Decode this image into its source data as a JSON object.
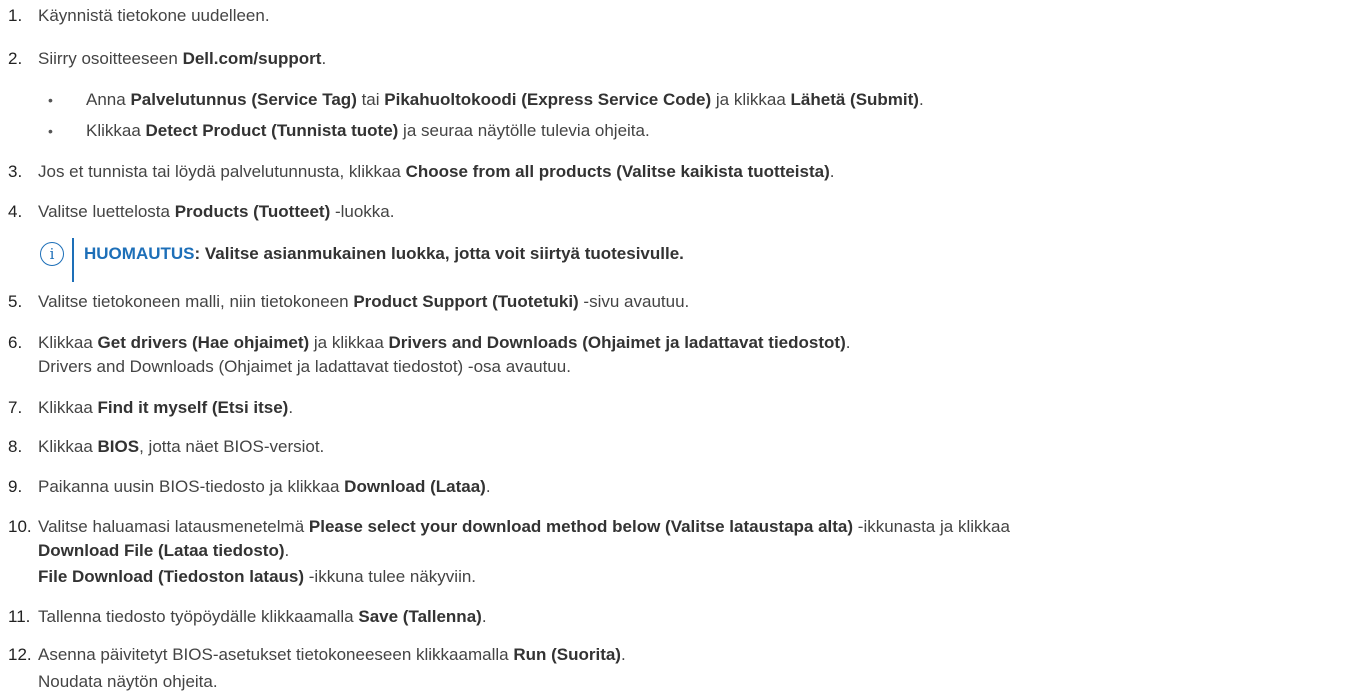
{
  "steps": [
    {
      "num": "1.",
      "text": "Käynnistä tietokone uudelleen."
    },
    {
      "num": "2.",
      "pre": "Siirry osoitteeseen ",
      "b1": "Dell.com/support",
      "post": "."
    },
    {
      "num": "3.",
      "pre": "Jos et tunnista tai löydä palvelutunnusta, klikkaa ",
      "b1": "Choose from all products (Valitse kaikista tuotteista)",
      "post": "."
    },
    {
      "num": "4.",
      "pre": "Valitse luettelosta ",
      "b1": "Products (Tuotteet)",
      "post": " -luokka."
    },
    {
      "num": "5.",
      "pre": "Valitse tietokoneen malli, niin tietokoneen ",
      "b1": "Product Support (Tuotetuki)",
      "post": " -sivu avautuu."
    },
    {
      "num": "6.",
      "pre": "Klikkaa ",
      "b1": "Get drivers (Hae ohjaimet)",
      "mid": " ja klikkaa ",
      "b2": "Drivers and Downloads (Ohjaimet ja ladattavat tiedostot)",
      "post": ".",
      "line2": "Drivers and Downloads (Ohjaimet ja ladattavat tiedostot) -osa avautuu."
    },
    {
      "num": "7.",
      "pre": "Klikkaa ",
      "b1": "Find it myself (Etsi itse)",
      "post": "."
    },
    {
      "num": "8.",
      "pre": "Klikkaa ",
      "b1": "BIOS",
      "post": ", jotta näet BIOS-versiot."
    },
    {
      "num": "9.",
      "pre": "Paikanna uusin BIOS-tiedosto ja klikkaa ",
      "b1": "Download (Lataa)",
      "post": "."
    },
    {
      "num": "10.",
      "pre": "Valitse haluamasi latausmenetelmä ",
      "b1": "Please select your download method below (Valitse lataustapa alta)",
      "post": " -ikkunasta ja klikkaa",
      "line2_b": "Download File (Lataa tiedosto)",
      "line2_post": ".",
      "line3_b": "File Download (Tiedoston lataus)",
      "line3_post": " -ikkuna tulee näkyviin."
    },
    {
      "num": "11.",
      "pre": "Tallenna tiedosto työpöydälle klikkaamalla ",
      "b1": "Save (Tallenna)",
      "post": "."
    },
    {
      "num": "12.",
      "pre": "Asenna päivitetyt BIOS-asetukset tietokoneeseen klikkaamalla ",
      "b1": "Run (Suorita)",
      "post": ".",
      "after": "Noudata näytön ohjeita."
    }
  ],
  "substeps": [
    {
      "bullet": "•",
      "pre": "Anna ",
      "b1": "Palvelutunnus (Service Tag)",
      "mid1": " tai ",
      "b2": "Pikahuoltokoodi (Express Service Code)",
      "mid2": " ja klikkaa ",
      "b3": "Lähetä (Submit)",
      "post": "."
    },
    {
      "bullet": "•",
      "pre": "Klikkaa ",
      "b1": "Detect Product (Tunnista tuote)",
      "post": " ja seuraa näytölle tulevia ohjeita."
    }
  ],
  "note": {
    "icon": "info-icon",
    "icon_glyph": "i",
    "label": "HUOMAUTUS",
    "text": ": Valitse asianmukainen luokka, jotta voit siirtyä tuotesivulle.",
    "accent_color": "#1d6fb8"
  }
}
